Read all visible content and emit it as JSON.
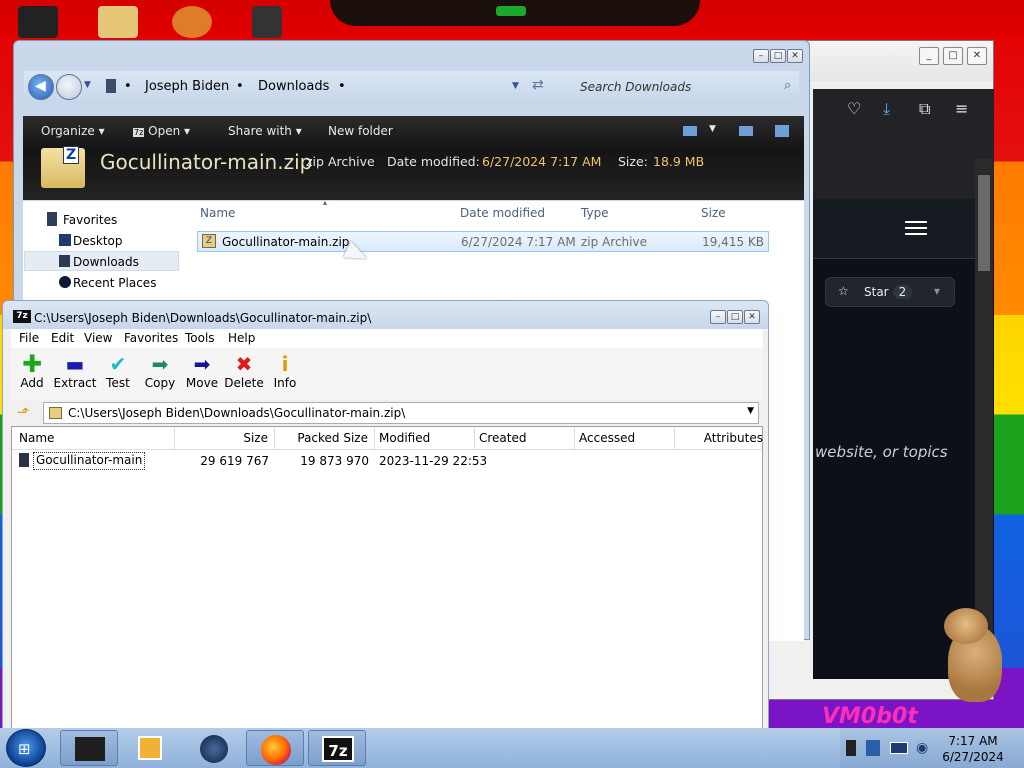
{
  "explorer": {
    "breadcrumb": [
      "Joseph Biden",
      "Downloads"
    ],
    "search_placeholder": "Search Downloads",
    "toolbar": {
      "organize": "Organize",
      "open": "Open",
      "share_with": "Share with",
      "new_folder": "New folder"
    },
    "details": {
      "filename": "Gocullinator-main.zip",
      "type": "zip Archive",
      "date_label": "Date modified:",
      "date_value": "6/27/2024 7:17 AM",
      "size_label": "Size:",
      "size_value": "18.9 MB"
    },
    "nav": {
      "favorites": "Favorites",
      "desktop": "Desktop",
      "downloads": "Downloads",
      "recent_places": "Recent Places"
    },
    "columns": {
      "name": "Name",
      "date_modified": "Date modified",
      "type": "Type",
      "size": "Size"
    },
    "files": [
      {
        "name": "Gocullinator-main.zip",
        "date": "6/27/2024 7:17 AM",
        "type": "zip Archive",
        "size": "19,415 KB"
      }
    ]
  },
  "sevenzip": {
    "title": "C:\\Users\\Joseph Biden\\Downloads\\Gocullinator-main.zip\\",
    "menu": [
      "File",
      "Edit",
      "View",
      "Favorites",
      "Tools",
      "Help"
    ],
    "tools": [
      "Add",
      "Extract",
      "Test",
      "Copy",
      "Move",
      "Delete",
      "Info"
    ],
    "path": "C:\\Users\\Joseph Biden\\Downloads\\Gocullinator-main.zip\\",
    "columns": [
      "Name",
      "Size",
      "Packed Size",
      "Modified",
      "Created",
      "Accessed",
      "Attributes"
    ],
    "rows": [
      {
        "name": "Gocullinator-main",
        "size": "29 619 767",
        "packed": "19 873 970",
        "modified": "2023-11-29 22:53"
      }
    ]
  },
  "firefox": {
    "star_label": "Star",
    "star_count": "2",
    "hint": "website, or topics"
  },
  "taskbar": {
    "time": "7:17 AM",
    "date": "6/27/2024",
    "sevenzip_label": "7z"
  },
  "watermark": "VM0b0t",
  "colors": {
    "explorer_chrome": "#c9d8ea",
    "command_bar": "#1c1c1c",
    "selection": "#d9ebfc",
    "github_dark": "#0d1117"
  }
}
